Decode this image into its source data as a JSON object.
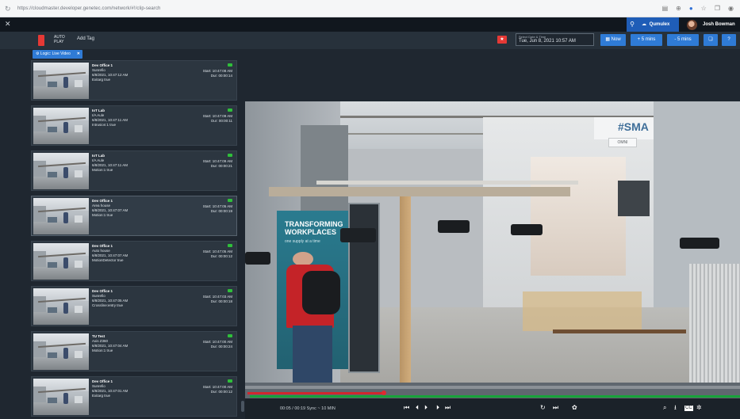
{
  "browser": {
    "url": "https://cloudmaster.developer.genetec.com/network/#!/clip-search"
  },
  "appbar": {
    "close_glyph": "✕",
    "location_icon": "map-pin-icon",
    "site_label": "Qumulex",
    "user_name": "Josh Bowman"
  },
  "toolbar": {
    "auto_label": "AUTO",
    "play_label": "PLAY",
    "add_tag_label": "Add Tag",
    "datetime_label": "Select Date & Time",
    "datetime_value": "Tue, Jun 8, 2021 10:57 AM",
    "now_label": "Now",
    "plus5_label": "+ 5 mins",
    "minus5_label": "- 5 mins",
    "help_label": "?"
  },
  "filter": {
    "chip_label": "Logic: Live Video"
  },
  "clips": [
    {
      "title": "Dev Office 1",
      "zone": "Sunrefio",
      "date": "6/8/2021, 10:47:12 AM",
      "trigger": "Exitarg true",
      "start": "Start: 10:47:08 AM",
      "dur": "Dur: 00:00:14"
    },
    {
      "title": "IoT Lab",
      "zone": "I/A Aule",
      "date": "6/8/2021, 10:47:11 AM",
      "trigger": "Intrusion:1 true",
      "start": "Start: 10:47:09 AM",
      "dur": "Dur: 00:00:11"
    },
    {
      "title": "IoT Lab",
      "zone": "I/A Aule",
      "date": "6/8/2021, 10:47:11 AM",
      "trigger": "Motion:1 true",
      "start": "Start: 10:47:09 AM",
      "dur": "Dur: 00:00:21"
    },
    {
      "title": "Dev Office 1",
      "zone": "Area house",
      "date": "6/8/2021, 10:47:07 AM",
      "trigger": "Motion:1 true",
      "start": "Start: 10:47:05 AM",
      "dur": "Dur: 00:00:19"
    },
    {
      "title": "Dev Office 1",
      "zone": "Auto house",
      "date": "6/8/2021, 10:47:07 AM",
      "trigger": "MotionDetector true",
      "start": "Start: 10:47:05 AM",
      "dur": "Dur: 00:00:12"
    },
    {
      "title": "Dev Office 1",
      "zone": "Sunrefio",
      "date": "6/8/2021, 10:47:05 AM",
      "trigger": "Crossline:entry true",
      "start": "Start: 10:47:03 AM",
      "dur": "Dur: 00:00:18"
    },
    {
      "title": "TU Test",
      "zone": "Axis Z360",
      "date": "6/8/2021, 10:47:04 AM",
      "trigger": "Motion:1 true",
      "start": "Start: 10:47:00 AM",
      "dur": "Dur: 00:00:24"
    },
    {
      "title": "Dev Office 1",
      "zone": "Sunrefio",
      "date": "6/8/2021, 10:47:01 AM",
      "trigger": "Exitarg true",
      "start": "Start: 10:47:00 AM",
      "dur": "Dur: 00:00:12"
    }
  ],
  "scene": {
    "banner_text": "TRANSFORMING WORKPLACES",
    "banner_sub": "one supply at a time",
    "wall_sign": "#SMA",
    "mini_sign": "OMNI"
  },
  "player": {
    "time_text": "00:05 / 00:19  Sync ~ 10 MIN",
    "colors": {
      "timeline_red": "#d0282e",
      "timeline_green": "#18a23a",
      "accent": "#2f7bd6"
    }
  }
}
